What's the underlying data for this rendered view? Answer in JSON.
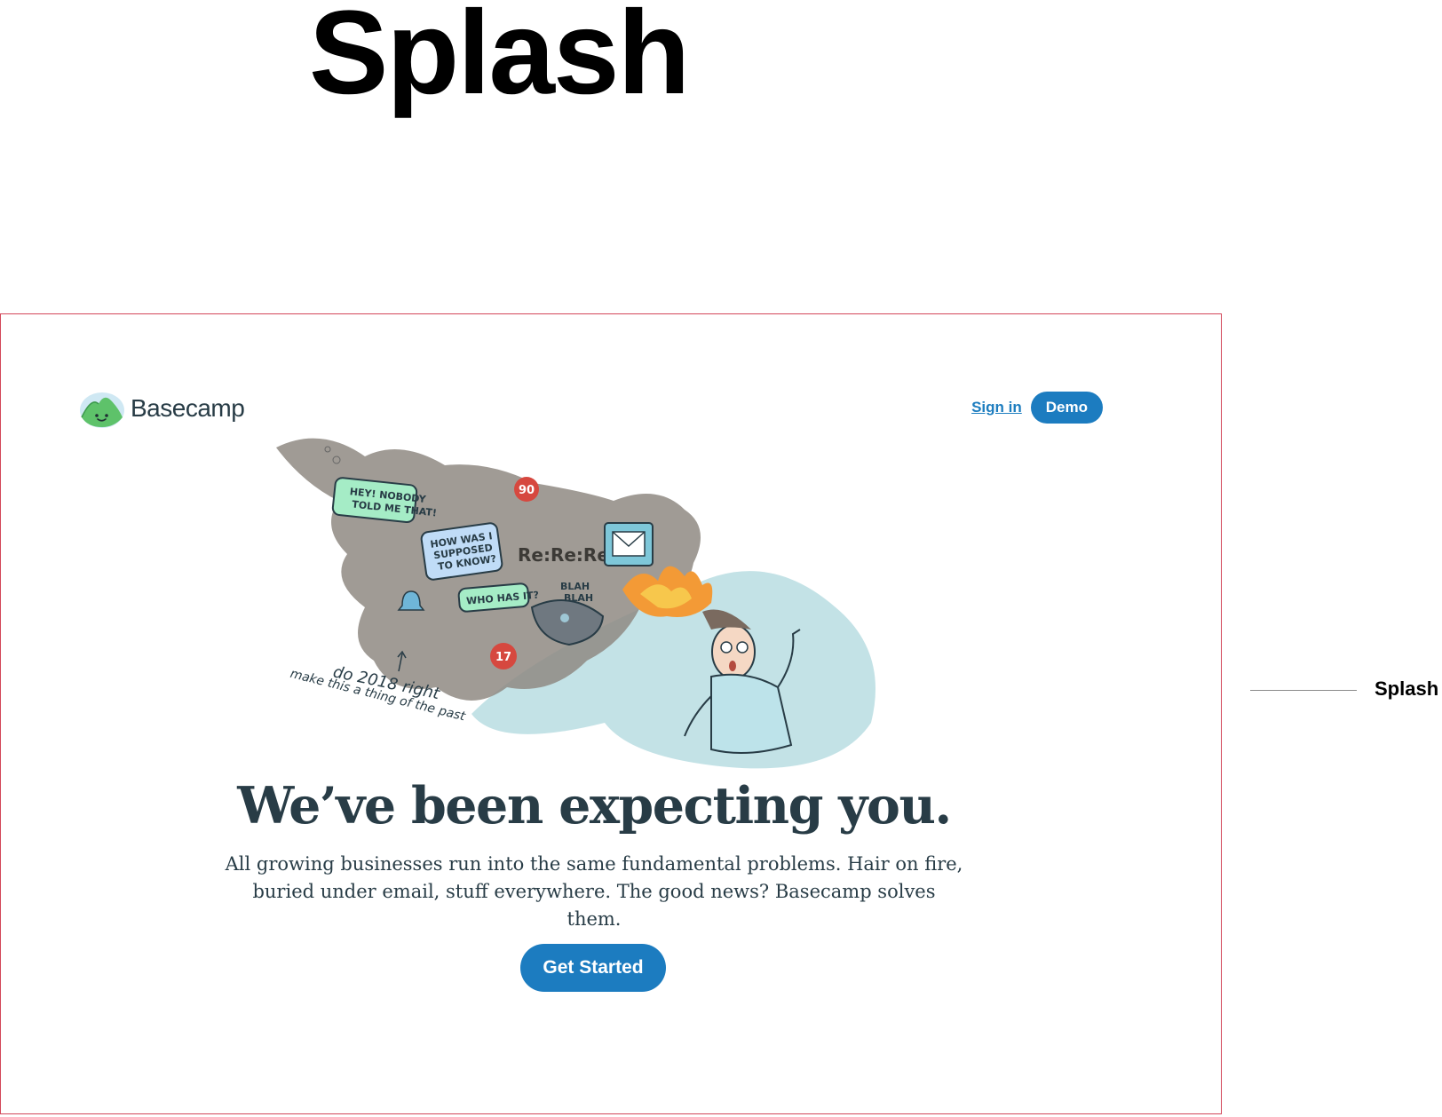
{
  "page": {
    "heading": "Splash",
    "annotation_label": "Splash"
  },
  "site": {
    "brand": "Basecamp",
    "nav": {
      "signin_label": "Sign in",
      "demo_label": "Demo"
    },
    "illustration": {
      "bubbles": [
        "HEY! NOBODY TOLD ME THAT!",
        "HOW WAS I SUPPOSED TO KNOW?",
        "WHO HAS IT?"
      ],
      "rerere": "Re:Re:Re:",
      "blah": "BLAH BLAH",
      "badge_top": "90",
      "badge_bottom": "17",
      "note_line1": "do 2018 right",
      "note_line2": "make this a thing of the past"
    },
    "hero": {
      "title": "We’ve been expecting you.",
      "text": "All growing businesses run into the same fundamental problems. Hair on fire, buried under email, stuff everywhere. The good news? Basecamp solves them.",
      "cta_label": "Get Started"
    },
    "colors": {
      "primary": "#1c7cc0",
      "text": "#283c46",
      "frame_border": "#d3475a"
    }
  }
}
